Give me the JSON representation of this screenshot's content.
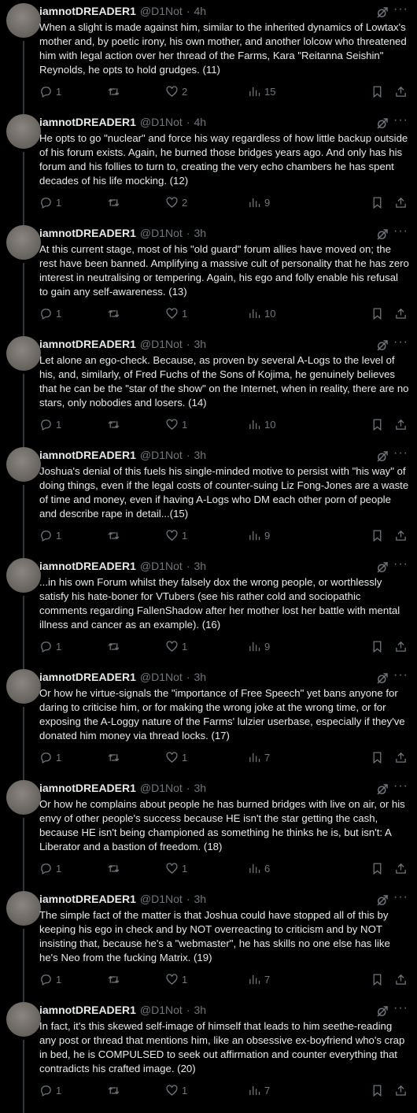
{
  "tweets": [
    {
      "name": "iamnotDREADER1",
      "handle": "@D1Not",
      "time": "4h",
      "text": "When a slight is made against him, similar to the inherited dynamics of Lowtax's mother and, by poetic irony, his own mother, and another lolcow who threatened him with legal action over her thread of the Farms, Kara \"Reitanna Seishin\" Reynolds, he opts to hold grudges. (11)",
      "replies": "1",
      "retweets": "",
      "likes": "2",
      "views": "15"
    },
    {
      "name": "iamnotDREADER1",
      "handle": "@D1Not",
      "time": "4h",
      "text": "He opts to go \"nuclear\" and force his way regardless of how little backup outside of his forum exists. Again, he burned those bridges years ago. And only has his forum and his follies to turn to, creating the very echo chambers he has spent decades of his life mocking. (12)",
      "replies": "1",
      "retweets": "",
      "likes": "2",
      "views": "9"
    },
    {
      "name": "iamnotDREADER1",
      "handle": "@D1Not",
      "time": "3h",
      "text": "At this current stage, most of his \"old guard\" forum allies have moved on; the rest have been banned. Amplifying a massive cult of personality that he has zero interest in neutralising or tempering. Again, his ego and folly enable his refusal to gain any self-awareness. (13)",
      "replies": "1",
      "retweets": "",
      "likes": "1",
      "views": "10"
    },
    {
      "name": "iamnotDREADER1",
      "handle": "@D1Not",
      "time": "3h",
      "text": "Let alone an ego-check. Because, as proven by several A-Logs to the level of his, and, similarly, of Fred Fuchs of the Sons of Kojima, he genuinely believes that he can be the \"star of the show\" on the Internet, when in reality, there are no stars, only nobodies and losers. (14)",
      "replies": "1",
      "retweets": "",
      "likes": "1",
      "views": "10"
    },
    {
      "name": "iamnotDREADER1",
      "handle": "@D1Not",
      "time": "3h",
      "text": "Joshua's denial of this fuels his single-minded motive to persist with \"his way\" of doing things, even if the legal costs of counter-suing Liz Fong-Jones are a waste of time and money, even if having A-Logs who DM each other porn of people and describe rape in detail...(15)",
      "replies": "1",
      "retweets": "",
      "likes": "1",
      "views": "9"
    },
    {
      "name": "iamnotDREADER1",
      "handle": "@D1Not",
      "time": "3h",
      "text": "...in his own Forum whilst they falsely dox the wrong people, or worthlessly satisfy his hate-boner for VTubers (see his rather cold and sociopathic comments regarding FallenShadow after her mother lost her battle with mental illness and cancer as an example). (16)",
      "replies": "1",
      "retweets": "",
      "likes": "1",
      "views": "9"
    },
    {
      "name": "iamnotDREADER1",
      "handle": "@D1Not",
      "time": "3h",
      "text": "Or how he virtue-signals the \"importance of Free Speech\" yet bans anyone for daring to criticise him, or for making the wrong joke at the wrong time, or for exposing the A-Loggy nature of the Farms' lulzier userbase, especially if they've donated him money via thread locks. (17)",
      "replies": "1",
      "retweets": "",
      "likes": "1",
      "views": "7"
    },
    {
      "name": "iamnotDREADER1",
      "handle": "@D1Not",
      "time": "3h",
      "text": "Or how he complains about people he has burned bridges with live on air, or his envy of other people's success because HE isn't the star getting the cash, because HE isn't being championed as something he thinks he is, but isn't: A Liberator and a bastion of freedom. (18)",
      "replies": "1",
      "retweets": "",
      "likes": "1",
      "views": "6"
    },
    {
      "name": "iamnotDREADER1",
      "handle": "@D1Not",
      "time": "3h",
      "text": "The simple fact of the matter is that Joshua could have stopped all of this by keeping his ego in check and by NOT overreacting to criticism and by NOT insisting that, because he's a \"webmaster\", he has skills no one else has like he's Neo from the fucking Matrix. (19)",
      "replies": "1",
      "retweets": "",
      "likes": "1",
      "views": "7"
    },
    {
      "name": "iamnotDREADER1",
      "handle": "@D1Not",
      "time": "3h",
      "text": "In fact, it's this skewed self-image of himself that leads to him seethe-reading any post or thread that mentions him, like an obsessive ex-boyfriend who's crap in bed, he is COMPULSED to seek out affirmation and counter everything that contradicts his crafted image. (20)",
      "replies": "1",
      "retweets": "",
      "likes": "1",
      "views": "7"
    }
  ],
  "icons": {
    "reply": "reply-icon",
    "retweet": "retweet-icon",
    "like": "heart-icon",
    "views": "views-icon",
    "bookmark": "bookmark-icon",
    "share": "share-icon",
    "grok": "grok-icon",
    "more": "more-icon"
  },
  "colors": {
    "background": "#000000",
    "text": "#e7e9ea",
    "muted": "#71767b",
    "thread_line": "#333639"
  }
}
